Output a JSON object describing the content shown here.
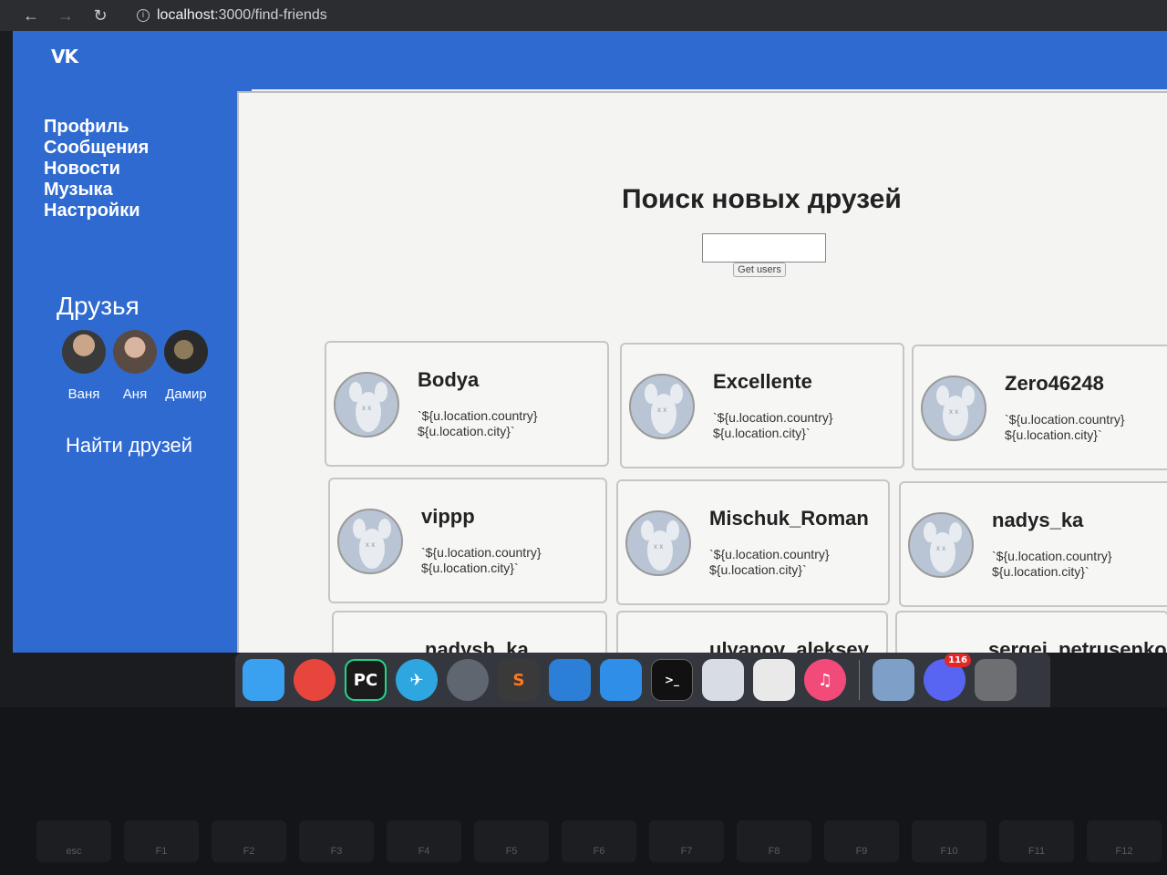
{
  "browser": {
    "url_host": "localhost",
    "url_path": ":3000/find-friends"
  },
  "app": {
    "logo_text": "VK"
  },
  "sidebar": {
    "menu": [
      {
        "label": "Профиль"
      },
      {
        "label": "Сообщения"
      },
      {
        "label": "Новости"
      },
      {
        "label": "Музыка"
      },
      {
        "label": "Настройки"
      }
    ],
    "friends_title": "Друзья",
    "friends": [
      {
        "name": "Ваня"
      },
      {
        "name": "Аня"
      },
      {
        "name": "Дамир"
      }
    ],
    "find_friends": "Найти друзей"
  },
  "main": {
    "title": "Поиск новых друзей",
    "search_value": "",
    "get_users_label": "Get users",
    "users": [
      {
        "username": "Bodya",
        "location_line1": "`${u.location.country}",
        "location_line2": "${u.location.city}`"
      },
      {
        "username": "Excellente",
        "location_line1": "`${u.location.country}",
        "location_line2": "${u.location.city}`"
      },
      {
        "username": "Zero46248",
        "location_line1": "`${u.location.country}",
        "location_line2": "${u.location.city}`"
      },
      {
        "username": "vippp",
        "location_line1": "`${u.location.country}",
        "location_line2": "${u.location.city}`"
      },
      {
        "username": "Mischuk_Roman",
        "location_line1": "`${u.location.country}",
        "location_line2": "${u.location.city}`"
      },
      {
        "username": "nadys_ka",
        "location_line1": "`${u.location.country}",
        "location_line2": "${u.location.city}`"
      },
      {
        "username": "nadysh_ka",
        "location_line1": "",
        "location_line2": ""
      },
      {
        "username": "ulyanov_aleksey",
        "location_line1": "",
        "location_line2": ""
      },
      {
        "username": "sergei_petrusenko",
        "location_line1": "",
        "location_line2": ""
      }
    ]
  },
  "dock": {
    "apps": [
      {
        "name": "finder-icon",
        "label": "",
        "color": "#3aa0f0"
      },
      {
        "name": "chrome-icon",
        "label": "",
        "color": "#e8453c"
      },
      {
        "name": "pycharm-icon",
        "label": "PC",
        "color": "#1b1b1b"
      },
      {
        "name": "telegram-icon",
        "label": "✈",
        "color": "#2ea6df"
      },
      {
        "name": "owl-icon",
        "label": "",
        "color": "#5f6670"
      },
      {
        "name": "sublime-icon",
        "label": "S",
        "color": "#ff7a1a"
      },
      {
        "name": "vscode-icon",
        "label": "",
        "color": "#2b7fd6"
      },
      {
        "name": "xcode-icon",
        "label": "",
        "color": "#2f8fe8"
      },
      {
        "name": "terminal-icon",
        "label": ">_",
        "color": "#111"
      },
      {
        "name": "preview-icon",
        "label": "",
        "color": "#d8dde4"
      },
      {
        "name": "document-icon",
        "label": "",
        "color": "#e9e9e9"
      },
      {
        "name": "itunes-icon",
        "label": "♫",
        "color": "#f24b7a"
      },
      {
        "name": "photos-icon",
        "label": "",
        "color": "#7ea0c8"
      },
      {
        "name": "discord-icon",
        "label": "",
        "color": "#5865f2",
        "badge": "116"
      },
      {
        "name": "trash-icon",
        "label": "",
        "color": "#6d6f73"
      }
    ]
  },
  "keyboard": {
    "keys": [
      "esc",
      "F1",
      "F2",
      "F3",
      "F4",
      "F5",
      "F6",
      "F7",
      "F8",
      "F9",
      "F10",
      "F11",
      "F12"
    ]
  }
}
